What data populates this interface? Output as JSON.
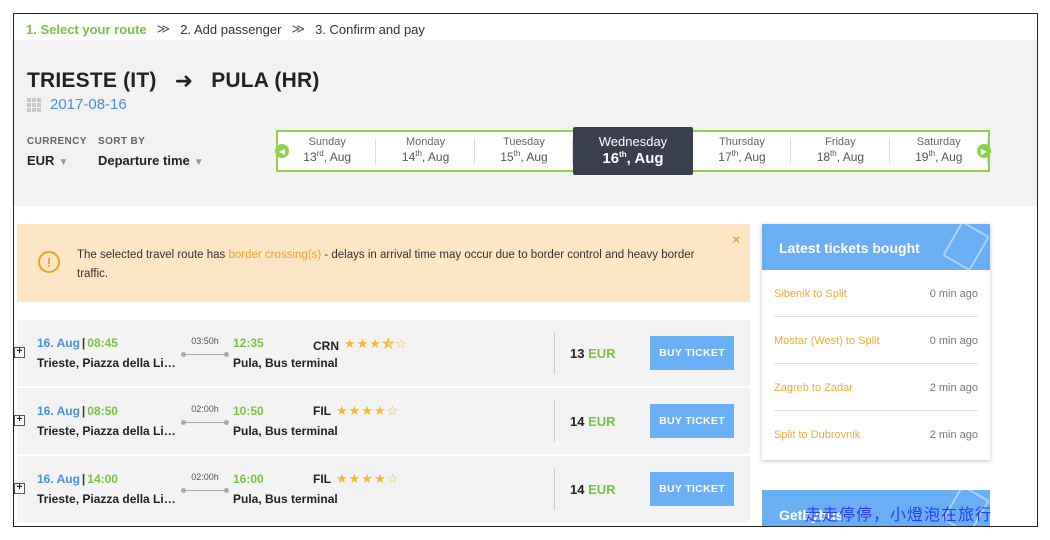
{
  "steps": [
    {
      "label": "1. Select your route"
    },
    {
      "label": "2. Add passenger"
    },
    {
      "label": "3. Confirm and pay"
    }
  ],
  "step_separator": "≫",
  "route": {
    "from": "TRIESTE (IT)",
    "arrow": "➜",
    "to": "PULA (HR)",
    "date": "2017-08-16"
  },
  "filters": {
    "currency_label": "CURRENCY",
    "currency_value": "EUR",
    "sort_label": "SORT BY",
    "sort_value": "Departure time"
  },
  "dates": [
    {
      "name": "Sunday",
      "num": "13",
      "suffix": "rd",
      "month": ", Aug"
    },
    {
      "name": "Monday",
      "num": "14",
      "suffix": "th",
      "month": ", Aug"
    },
    {
      "name": "Tuesday",
      "num": "15",
      "suffix": "th",
      "month": ", Aug"
    },
    {
      "name": "Wednesday",
      "num": "16",
      "suffix": "th",
      "month": ", Aug"
    },
    {
      "name": "Thursday",
      "num": "17",
      "suffix": "th",
      "month": ", Aug"
    },
    {
      "name": "Friday",
      "num": "18",
      "suffix": "th",
      "month": ", Aug"
    },
    {
      "name": "Saturday",
      "num": "19",
      "suffix": "th",
      "month": ", Aug"
    }
  ],
  "alert": {
    "before": "The selected travel route has ",
    "link": "border crossing(s)",
    "after": " - delays in arrival time may occur due to border control and heavy border traffic.",
    "close": "×"
  },
  "trips": [
    {
      "date": "16. Aug",
      "dep": "08:45",
      "from": "Trieste, Piazza della Libertà",
      "duration": "03:50h",
      "arr": "12:35",
      "to": "Pula, Bus terminal",
      "operator": "CRN",
      "stars": "★★★⯪☆",
      "price": "13",
      "currency": "EUR",
      "buy": "BUY TICKET"
    },
    {
      "date": "16. Aug",
      "dep": "08:50",
      "from": "Trieste, Piazza della Libertà",
      "duration": "02:00h",
      "arr": "10:50",
      "to": "Pula, Bus terminal",
      "operator": "FIL",
      "stars": "★★★★☆",
      "price": "14",
      "currency": "EUR",
      "buy": "BUY TICKET"
    },
    {
      "date": "16. Aug",
      "dep": "14:00",
      "from": "Trieste, Piazza della Libertà",
      "duration": "02:00h",
      "arr": "16:00",
      "to": "Pula, Bus terminal",
      "operator": "FIL",
      "stars": "★★★★☆",
      "price": "14",
      "currency": "EUR",
      "buy": "BUY TICKET"
    }
  ],
  "sidebar": {
    "title": "Latest tickets bought",
    "items": [
      {
        "route": "Sibenik to Split",
        "ago": "0 min ago"
      },
      {
        "route": "Mostar (West) to Split",
        "ago": "0 min ago"
      },
      {
        "route": "Zagreb to Zadar",
        "ago": "2 min ago"
      },
      {
        "route": "Split to Dubrovnik",
        "ago": "2 min ago"
      }
    ],
    "second_title": "Getbybus"
  },
  "watermark": "走走停停，小燈泡在旅行"
}
